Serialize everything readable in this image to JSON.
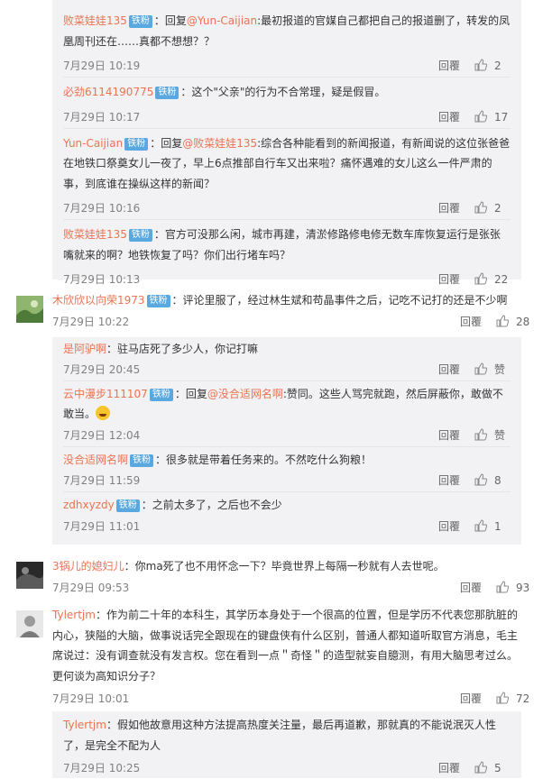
{
  "actions": {
    "reply_label": "回覆"
  },
  "sub_threads": [
    {
      "items": [
        {
          "user": "败菜娃娃135",
          "badge": "铁粉",
          "prefix": "：回复",
          "mention": "@Yun-Caijian",
          "text": ":最初报道的官媒自己都把自己的报道删了，转发的凤凰周刊还在……真都不想想？？",
          "time": "7月29日 10:19",
          "likes": "2"
        },
        {
          "user": "必劲6114190775",
          "badge": "铁粉",
          "prefix": "",
          "mention": "",
          "text": "：这个\"父亲\"的行为不合常理，疑是假冒。",
          "time": "7月29日 10:17",
          "likes": "17"
        },
        {
          "user": "Yun-Caijian",
          "badge": "铁粉",
          "prefix": "：回复",
          "mention": "@败菜娃娃135",
          "text": ":综合各种能看到的新闻报道，有新闻说的这位张爸爸在地铁口祭奠女儿一夜了，早上6点推部自行车又出来啦？痛怀遇难的女儿这么一件严肃的事，到底谁在操纵这样的新闻？",
          "time": "7月29日 10:16",
          "likes": "2"
        },
        {
          "user": "败菜娃娃135",
          "badge": "铁粉",
          "prefix": "",
          "mention": "",
          "text": "：官方可没那么闲，城市再建，清淤修路修电修无数车库恢复运行是张张嘴就来的啊？地铁恢复了吗？你们出行堵车吗？",
          "time": "7月29日 10:13",
          "likes": "22"
        }
      ]
    },
    {
      "items": [
        {
          "user": "是阿驴啊",
          "badge": "",
          "prefix": "",
          "mention": "",
          "text": "：驻马店死了多少人，你记打嘛",
          "time": "7月29日 20:45",
          "likes": "赞"
        },
        {
          "user": "云中漫步111107",
          "badge": "铁粉",
          "prefix": "：回复",
          "mention": "@没合适网名啊",
          "text": ":赞同。这些人骂完就跑，然后屏蔽你，敢做不敢当。",
          "time": "7月29日 12:04",
          "likes": "赞",
          "emoji": true
        },
        {
          "user": "没合适网名啊",
          "badge": "铁粉",
          "prefix": "",
          "mention": "",
          "text": "：很多就是带着任务来的。不然吃什么狗粮！",
          "time": "7月29日 11:59",
          "likes": "8"
        },
        {
          "user": "zdhxyzdy",
          "badge": "铁粉",
          "prefix": "",
          "mention": "",
          "text": "：之前太多了，之后也不会少",
          "time": "7月29日 11:01",
          "likes": "1"
        }
      ]
    },
    {
      "items": [
        {
          "user": "Tylertjm",
          "badge": "",
          "prefix": "",
          "mention": "",
          "text": "：假如他故意用这种方法提高热度关注量，最后再道歉，那就真的不能说泯灭人性了，是完全不配为人",
          "time": "7月29日 10:25",
          "likes": "5"
        }
      ]
    }
  ],
  "top_comments": [
    {
      "user": "木欣欣以向荣1973",
      "badge": "铁粉",
      "text": "：评论里服了，经过林生斌和苟晶事件之后，记吃不记打的还是不少啊",
      "time": "7月29日 10:22",
      "likes": "28"
    },
    {
      "user": "3锅儿的媳妇儿",
      "badge": "",
      "text": "：你ma死了也不用怀念一下？毕竟世界上每隔一秒就有人去世呢。",
      "time": "7月29日 09:53",
      "likes": "93"
    },
    {
      "user": "Tylertjm",
      "badge": "",
      "text": "：作为前二十年的本科生，其学历本身处于一个很高的位置，但是学历不代表您那肮脏的内心，狭隘的大脑，做事说话完全跟现在的键盘侠有什么区别，普通人都知道听取官方消息，毛主席说过：没有调查就没有发言权。您在看到一点＂奇怪＂的造型就妄自臆测，有用大脑思考过么。更何谈为高知识分子？",
      "time": "7月29日 10:01",
      "likes": "72"
    }
  ]
}
